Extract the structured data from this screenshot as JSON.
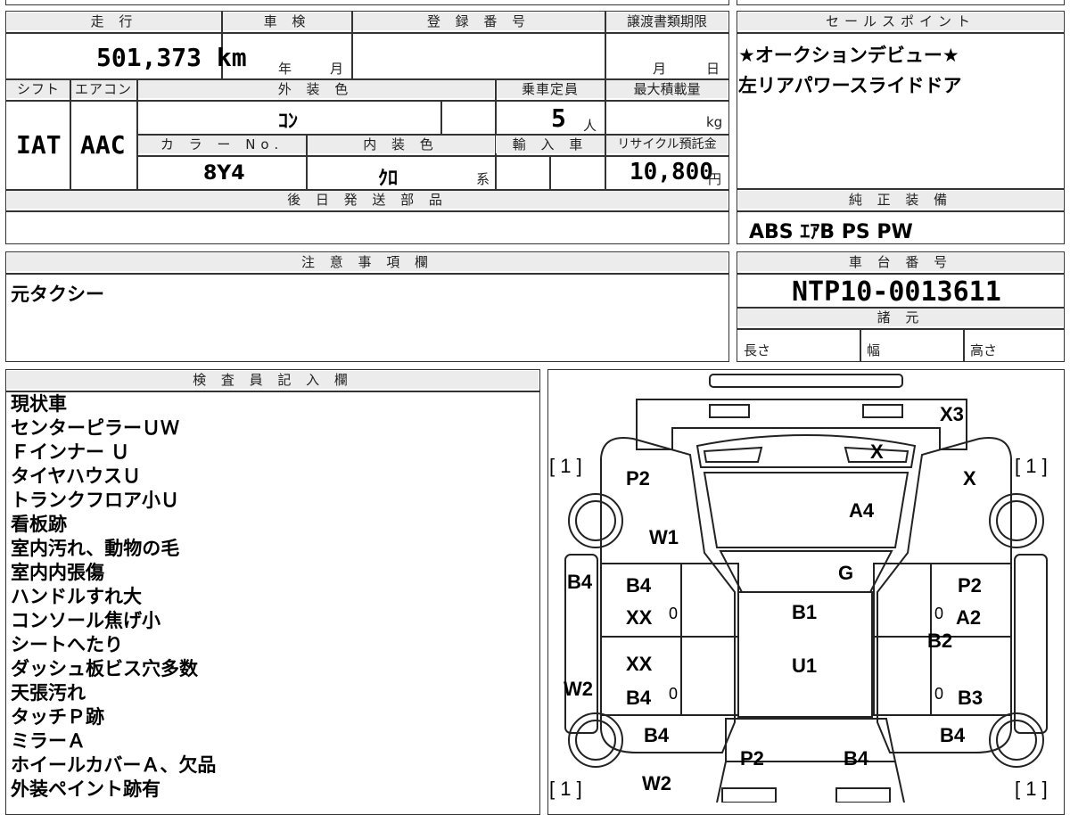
{
  "headers": {
    "mileage": "走 行",
    "inspection": "車 検",
    "registration": "登 録 番 号",
    "transfer_deadline": "譲渡書類期限",
    "sales_point": "セールスポイント",
    "shift": "シフト",
    "aircon": "エアコン",
    "exterior_color": "外 装 色",
    "capacity": "乗車定員",
    "max_load": "最大積載量",
    "color_no": "カ ラ ー No.",
    "interior_color": "内 装 色",
    "import": "輸 入 車",
    "recycle": "リサイクル預託金",
    "later_parts": "後 日 発 送 部 品",
    "genuine_equipment": "純 正 装 備",
    "notes": "注 意 事 項 欄",
    "chassis_no": "車 台 番 号",
    "specs": "諸 元",
    "inspector": "検 査 員 記 入 欄"
  },
  "values": {
    "mileage": "501,373 km",
    "year_unit": "年",
    "month_unit": "月",
    "deadline_month": "月",
    "deadline_day": "日",
    "shift": "IAT",
    "aircon": "AAC",
    "exterior_color": "ｺﾝ",
    "capacity": "5",
    "capacity_unit": "人",
    "load_unit": "kg",
    "color_no": "8Y4",
    "interior_color": "ｸﾛ",
    "interior_suffix": "系",
    "recycle": "10,800",
    "yen": "円",
    "genuine_equipment": "ABS ｴｱB PS PW",
    "notes": "元タクシー",
    "chassis_no": "NTP10-0013611",
    "length": "長さ",
    "width": "幅",
    "height": "高さ"
  },
  "sales_points": [
    "★オークションデビュー★",
    "左リアパワースライドドア"
  ],
  "inspector_notes": [
    "現状車",
    "センターピラーＵＷ",
    "Ｆインナー Ｕ",
    "タイヤハウスＵ",
    "トランクフロア小Ｕ",
    "看板跡",
    "室内汚れ、動物の毛",
    "室内内張傷",
    "ハンドルすれ大",
    "コンソール焦げ小",
    "シートへたり",
    "ダッシュ板ビス穴多数",
    "天張汚れ",
    "タッチＰ跡",
    "ミラーＡ",
    "ホイールカバーＡ、欠品",
    "外装ペイント跡有"
  ],
  "damage_map": {
    "tire_fl": "[ 1 ]",
    "tire_fr": "[ 1 ]",
    "tire_rl": "[ 1 ]",
    "tire_rr": "[ 1 ]",
    "x3": "X3",
    "x_a": "X",
    "x_b": "X",
    "p2_a": "P2",
    "a4": "A4",
    "w1": "W1",
    "g": "G",
    "b4_a": "B4",
    "b4_b": "B4",
    "p2_b": "P2",
    "xx_a": "XX",
    "b1": "B1",
    "a2": "A2",
    "b2": "B2",
    "xx_b": "XX",
    "u1": "U1",
    "w2_a": "W2",
    "b4_c": "B4",
    "b3": "B3",
    "b4_d": "B4",
    "b4_e": "B4",
    "p2_c": "P2",
    "b4_f": "B4",
    "w2_b": "W2",
    "zero_1": "0",
    "zero_2": "0",
    "zero_3": "0",
    "zero_4": "0"
  }
}
